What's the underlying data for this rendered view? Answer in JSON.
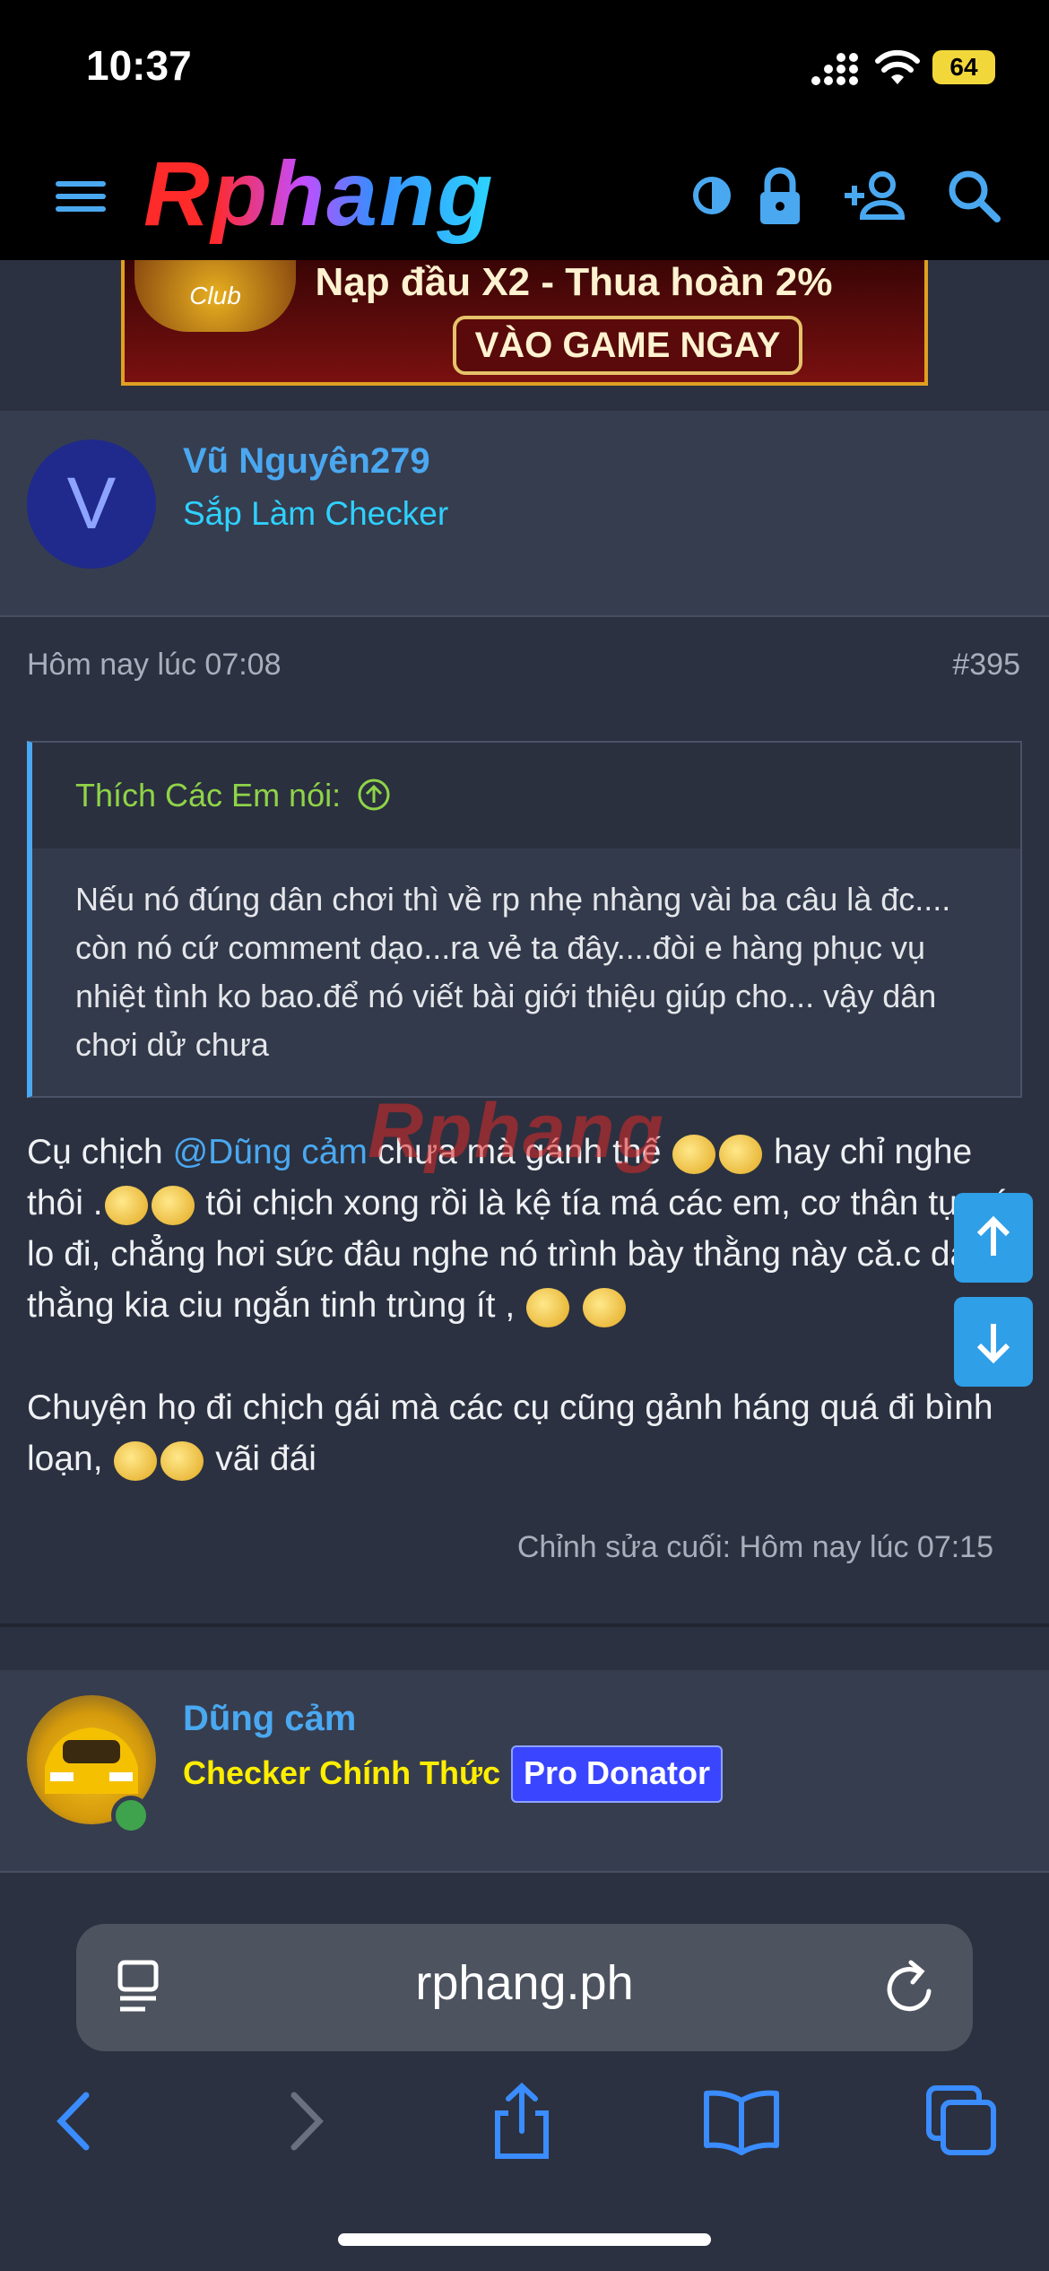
{
  "status_bar": {
    "time": "10:37",
    "battery": "64"
  },
  "header": {
    "logo": "Rphang"
  },
  "banner": {
    "club": "Club",
    "text": "Nạp đầu X2 - Thua hoàn 2%",
    "button": "VÀO GAME NGAY"
  },
  "post": {
    "user": {
      "avatar_letter": "V",
      "name": "Vũ Nguyên279",
      "title": "Sắp Làm Checker"
    },
    "date": "Hôm nay lúc 07:08",
    "number": "#395",
    "quote": {
      "author": "Thích Các Em nói:",
      "text": "Nếu nó đúng dân chơi thì về rp nhẹ nhàng vài ba câu là đc.... còn nó cứ comment dạo...ra vẻ ta đây....đòi e hàng phục vụ nhiệt tình ko bao.để nó viết bài giới thiệu giúp cho... vậy dân chơi dử chưa"
    },
    "body": {
      "p1_a": "Cụ chịch ",
      "mention": "@Dũng cảm",
      "p1_b": " chưa mà gánh thế ",
      "p1_c": " hay chỉ nghe thôi .",
      "p1_d": " tôi chịch xong rồi là kệ tía má các em, cơ thân tự nó lo đi, chẳng hơi sức đâu nghe nó trình bày thằng này că.c dài thằng kia ciu ngắn tinh trùng ít ,",
      "p2_a": "Chuyện họ đi chịch gái mà các cụ cũng gảnh háng quá đi bình loạn, ",
      "p2_b": " vãi đái"
    },
    "edited": "Chỉnh sửa cuối: Hôm nay lúc 07:15",
    "watermark": "Rphang"
  },
  "next_post": {
    "user": {
      "name": "Dũng cảm",
      "title": "Checker Chính Thức",
      "badge": "Pro Donator"
    }
  },
  "browser": {
    "url": "rphang.ph"
  }
}
